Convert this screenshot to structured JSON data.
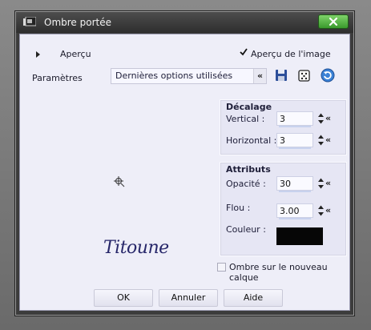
{
  "window": {
    "title": "Ombre portée"
  },
  "top": {
    "preview_label": "Aperçu",
    "image_preview_label": "Aperçu de l'image",
    "params_label": "Paramètres",
    "preset_value": "Dernières options utilisées"
  },
  "preview": {
    "signature": "Titoune"
  },
  "offset": {
    "title": "Décalage",
    "vertical_label": "Vertical :",
    "vertical_value": "3",
    "horizontal_label": "Horizontal :",
    "horizontal_value": "3"
  },
  "attributes": {
    "title": "Attributs",
    "opacity_label": "Opacité :",
    "opacity_value": "30",
    "blur_label": "Flou :",
    "blur_value": "3.00",
    "color_label": "Couleur :",
    "color_value": "#060606"
  },
  "shadow_layer_label": "Ombre sur le nouveau calque",
  "buttons": {
    "ok": "OK",
    "cancel": "Annuler",
    "help": "Aide"
  }
}
